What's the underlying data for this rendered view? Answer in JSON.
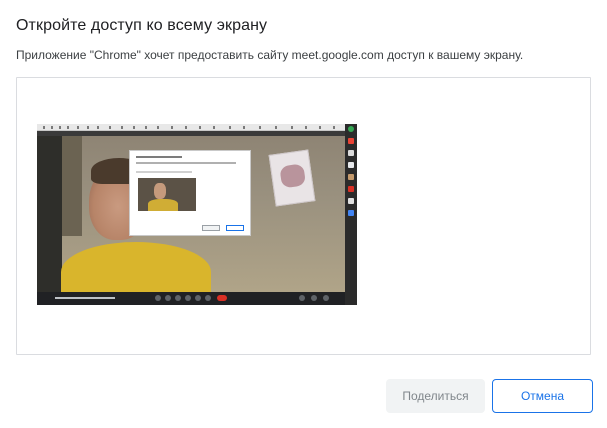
{
  "dialog": {
    "title": "Откройте доступ ко всему экрану",
    "description": "Приложение \"Chrome\" хочет предоставить сайту meet.google.com доступ к вашему экрану."
  },
  "preview": {
    "kind": "entire-screen-thumbnail"
  },
  "buttons": {
    "share_label": "Поделиться",
    "share_enabled": false,
    "cancel_label": "Отмена"
  },
  "colors": {
    "accent": "#1a73e8",
    "disabled_bg": "#f1f3f4",
    "disabled_text": "#80868b",
    "border": "#dadce0",
    "meet_end_call": "#d93025"
  }
}
